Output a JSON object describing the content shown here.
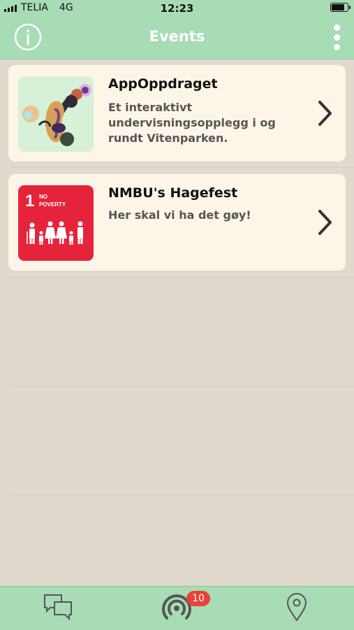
{
  "status_bar": {
    "carrier": "TELIA",
    "network": "4G",
    "time": "12:23",
    "battery_level": 0.9
  },
  "nav": {
    "title": "Events",
    "left_icon": "info-icon",
    "right_icon": "more-vertical-icon"
  },
  "events": [
    {
      "title": "AppOppdraget",
      "description": "Et interaktivt undervisningsopplegg i og rundt Vitenparken.",
      "thumbnail": "abstract-art-thumbnail"
    },
    {
      "title": "NMBU's Hagefest",
      "description": "Her skal vi ha det gøy!",
      "thumbnail": "no-poverty-thumbnail",
      "thumbnail_text": {
        "number": "1",
        "line1": "NO",
        "line2": "POVERTY"
      }
    }
  ],
  "tab_bar": {
    "tabs": [
      {
        "name": "chat-icon"
      },
      {
        "name": "broadcast-icon",
        "badge": "10"
      },
      {
        "name": "location-pin-icon"
      }
    ]
  },
  "colors": {
    "header_green": "#a8dcb5",
    "background": "#e0d9cd",
    "card": "#fdf6e8",
    "badge_red": "#e8413a",
    "poverty_red": "#e5243b"
  }
}
